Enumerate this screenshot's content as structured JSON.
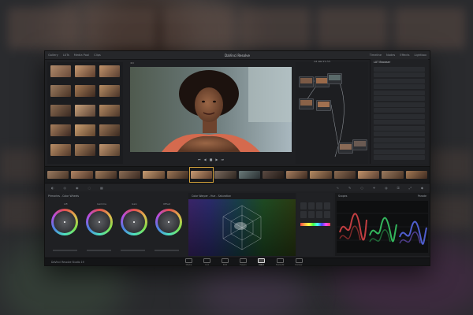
{
  "window": {
    "title": "DaVinci Resolve",
    "menus": [
      "Gallery",
      "LUTs",
      "Media Pool",
      "Clips",
      "Timeline",
      "Nodes",
      "Effects",
      "Lightbox"
    ]
  },
  "viewer": {
    "timecode": "01:00:22:22"
  },
  "lut_browser": {
    "header": "LUT Browser",
    "items": [
      "",
      "",
      "",
      "",
      "",
      "",
      "",
      "",
      "",
      "",
      "",
      "",
      "",
      "",
      "",
      ""
    ]
  },
  "color_wheels": {
    "header": "Primaries - Color Wheels",
    "wheels": [
      "Lift",
      "Gamma",
      "Gain",
      "Offset"
    ]
  },
  "vector_panel": {
    "header": "Color Warper - Hue - Saturation"
  },
  "scope": {
    "header": "Scopes",
    "mode": "Parade"
  },
  "footer": {
    "brand": "DaVinci Resolve Studio 19",
    "pages": [
      "Media",
      "Cut",
      "Edit",
      "Fusion",
      "Color",
      "Fairlight",
      "Deliver"
    ],
    "active_page": "Color"
  },
  "colors": {
    "accent": "#d1a03b",
    "panel": "#1f2023",
    "skin": "#8a5a3c"
  }
}
